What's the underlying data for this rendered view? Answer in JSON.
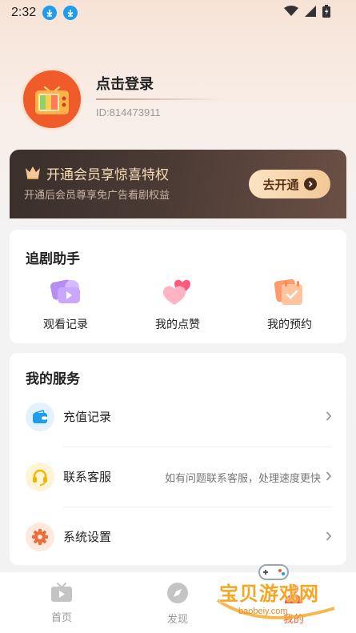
{
  "status_bar": {
    "time": "2:32"
  },
  "profile": {
    "login_label": "点击登录",
    "user_id": "ID:814473911"
  },
  "vip": {
    "title": "开通会员享惊喜特权",
    "subtitle": "开通后会员尊享免广告看剧权益",
    "button_label": "去开通"
  },
  "helper": {
    "title": "追剧助手",
    "items": [
      {
        "label": "观看记录",
        "icon": "history-icon"
      },
      {
        "label": "我的点赞",
        "icon": "hearts-icon"
      },
      {
        "label": "我的预约",
        "icon": "calendar-check-icon"
      }
    ]
  },
  "services": {
    "title": "我的服务",
    "items": [
      {
        "label": "充值记录",
        "icon": "wallet-icon",
        "hint": ""
      },
      {
        "label": "联系客服",
        "icon": "headset-icon",
        "hint": "如有问题联系客服，处理速度更快"
      },
      {
        "label": "系统设置",
        "icon": "gear-icon",
        "hint": ""
      }
    ]
  },
  "tabbar": {
    "items": [
      {
        "label": "首页",
        "icon": "tv-icon"
      },
      {
        "label": "发现",
        "icon": "compass-icon"
      },
      {
        "label": "我的",
        "icon": "user-icon"
      }
    ]
  },
  "watermark": {
    "text": "宝贝游戏网",
    "url": "baobeiy.com"
  },
  "colors": {
    "accent": "#ef5c2a",
    "vip_dark": "#3a2f2b",
    "vip_gold": "#f3c896",
    "blue": "#1e9cf0"
  }
}
